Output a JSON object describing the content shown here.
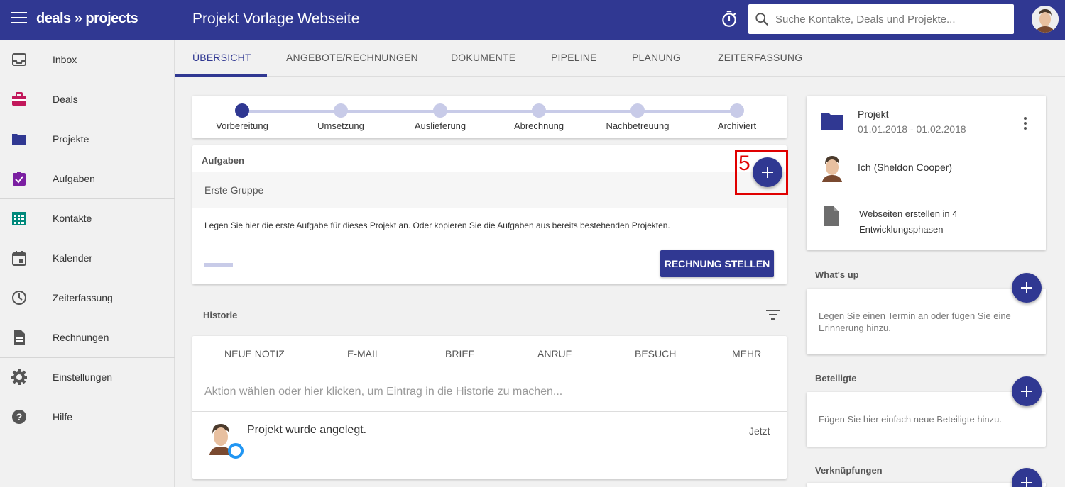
{
  "app": {
    "logo": "deals » projects",
    "page_title": "Projekt Vorlage Webseite",
    "search_placeholder": "Suche Kontakte, Deals und Projekte..."
  },
  "colors": {
    "primary": "#303892",
    "accent_red": "#e00000",
    "deals": "#c2185b",
    "tasks": "#7b1fa2",
    "contacts": "#00897b",
    "status_ring": "#2196f3"
  },
  "sidebar": {
    "items": [
      {
        "label": "Inbox",
        "icon": "inbox-icon"
      },
      {
        "label": "Deals",
        "icon": "briefcase-icon"
      },
      {
        "label": "Projekte",
        "icon": "folder-icon"
      },
      {
        "label": "Aufgaben",
        "icon": "clipboard-check-icon"
      },
      {
        "label": "Kontakte",
        "icon": "contacts-grid-icon"
      },
      {
        "label": "Kalender",
        "icon": "calendar-icon"
      },
      {
        "label": "Zeiterfassung",
        "icon": "clock-icon"
      },
      {
        "label": "Rechnungen",
        "icon": "document-icon"
      },
      {
        "label": "Einstellungen",
        "icon": "gear-icon"
      },
      {
        "label": "Hilfe",
        "icon": "help-icon"
      }
    ]
  },
  "tabs": [
    "Übersicht",
    "Angebote/Rechnungen",
    "Dokumente",
    "Pipeline",
    "Planung",
    "Zeiterfassung"
  ],
  "stepper": {
    "steps": [
      "Vorbereitung",
      "Umsetzung",
      "Auslieferung",
      "Abrechnung",
      "Nachbetreuung",
      "Archiviert"
    ],
    "active_index": 0
  },
  "tasks": {
    "title": "Aufgaben",
    "group": "Erste Gruppe",
    "hint": "Legen Sie hier die erste Aufgabe für dieses Projekt an. Oder kopieren Sie die Aufgaben aus bereits bestehenden Projekten.",
    "invoice_button": "RECHNUNG STELLEN",
    "highlight_number": "5"
  },
  "history": {
    "title": "Historie",
    "tabs": [
      "NEUE NOTIZ",
      "E-MAIL",
      "BRIEF",
      "ANRUF",
      "BESUCH",
      "MEHR"
    ],
    "input_placeholder": "Aktion wählen oder hier klicken, um Eintrag in die Historie zu machen...",
    "entry": {
      "text": "Projekt wurde angelegt.",
      "time": "Jetzt"
    }
  },
  "project": {
    "title": "Projekt",
    "dates": "01.01.2018 - 01.02.2018",
    "owner": "Ich (Sheldon Cooper)",
    "description": "Webseiten erstellen in 4 Entwicklungsphasen"
  },
  "whats_up": {
    "title": "What's up",
    "hint": "Legen Sie einen Termin an oder fügen Sie eine Erinnerung hinzu."
  },
  "participants": {
    "title": "Beteiligte",
    "hint": "Fügen Sie hier einfach neue Beteiligte hinzu."
  },
  "links": {
    "title": "Verknüpfungen"
  }
}
